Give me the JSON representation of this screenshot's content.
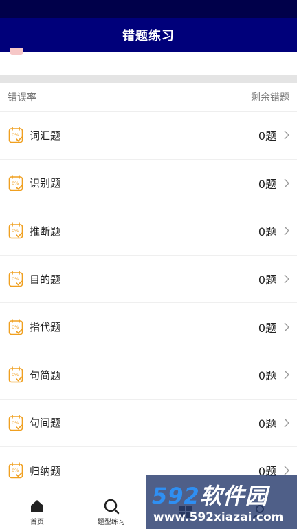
{
  "header": {
    "title": "错题练习"
  },
  "list_header": {
    "left": "错误率",
    "right": "剩余错题"
  },
  "rows": [
    {
      "label": "词汇题",
      "count": "0题",
      "badge": "0%"
    },
    {
      "label": "识别题",
      "count": "0题",
      "badge": "0%"
    },
    {
      "label": "推断题",
      "count": "0题",
      "badge": "0%"
    },
    {
      "label": "目的题",
      "count": "0题",
      "badge": "0%"
    },
    {
      "label": "指代题",
      "count": "0题",
      "badge": "0%"
    },
    {
      "label": "句简题",
      "count": "0题",
      "badge": "0%"
    },
    {
      "label": "句间题",
      "count": "0题",
      "badge": "0%"
    },
    {
      "label": "归纳题",
      "count": "0题",
      "badge": "0%"
    }
  ],
  "tabbar": {
    "tabs": [
      {
        "label": "首页",
        "icon": "home-icon"
      },
      {
        "label": "题型练习",
        "icon": "search-icon"
      },
      {
        "label": "",
        "icon": "grid-icon"
      },
      {
        "label": "",
        "icon": "user-icon"
      }
    ]
  },
  "watermark": {
    "brand_num": "592",
    "brand_cn": "软件园",
    "url": "www.592xiazai.com"
  },
  "colors": {
    "header": "#00007a",
    "status_bar": "#00004a",
    "accent": "#f0a020",
    "divider": "#e4e4e4"
  }
}
